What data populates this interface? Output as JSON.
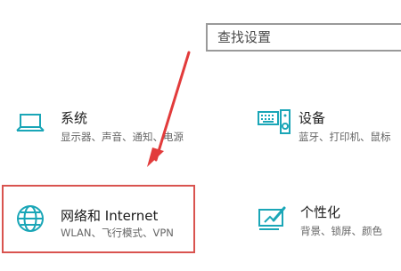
{
  "search": {
    "placeholder": "查找设置"
  },
  "tiles": [
    {
      "title": "系统",
      "description": "显示器、声音、通知、电源",
      "icon": "laptop-icon"
    },
    {
      "title": "设备",
      "description": "蓝牙、打印机、鼠标",
      "icon": "keyboard-speaker-icon"
    },
    {
      "title": "网络和 Internet",
      "description": "WLAN、飞行模式、VPN",
      "icon": "globe-icon"
    },
    {
      "title": "个性化",
      "description": "背景、锁屏、颜色",
      "icon": "paint-brush-icon"
    }
  ],
  "colors": {
    "accent": "#1aa6b7",
    "highlight_border": "#d9534f",
    "annotation_arrow": "#e23b3b"
  }
}
